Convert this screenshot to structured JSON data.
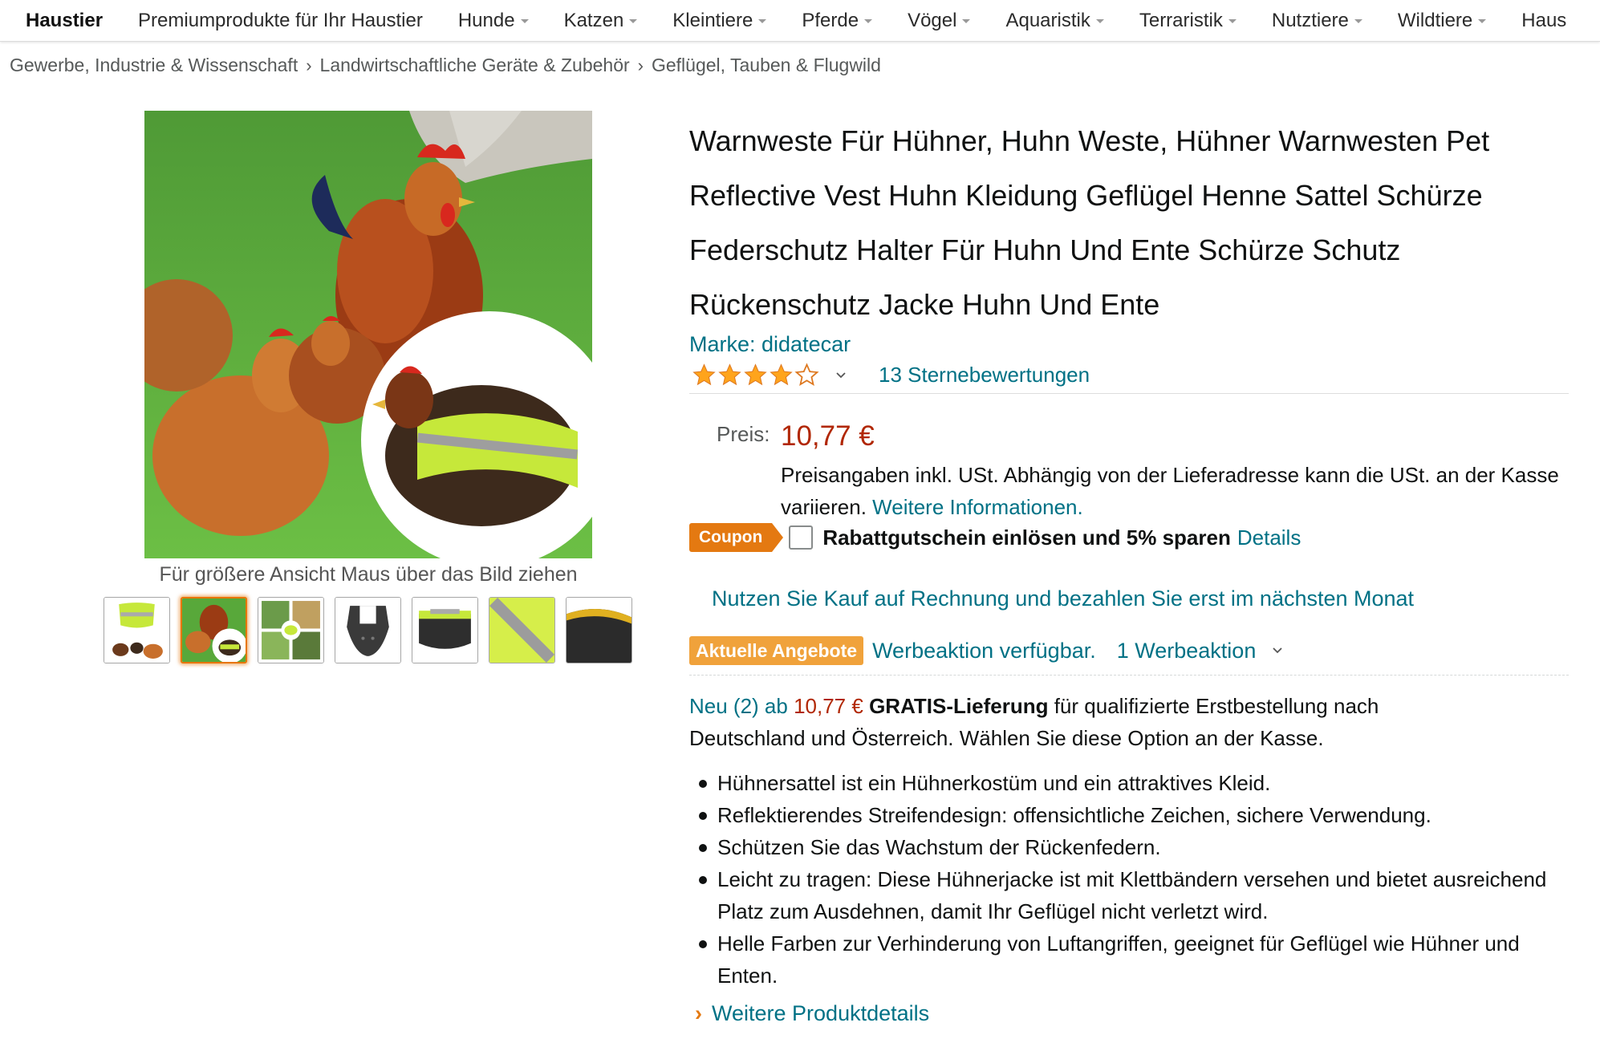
{
  "nav": {
    "first": "Haustier",
    "items": [
      {
        "label": "Premiumprodukte für Ihr Haustier",
        "caret": false
      },
      {
        "label": "Hunde",
        "caret": true
      },
      {
        "label": "Katzen",
        "caret": true
      },
      {
        "label": "Kleintiere",
        "caret": true
      },
      {
        "label": "Pferde",
        "caret": true
      },
      {
        "label": "Vögel",
        "caret": true
      },
      {
        "label": "Aquaristik",
        "caret": true
      },
      {
        "label": "Terraristik",
        "caret": true
      },
      {
        "label": "Nutztiere",
        "caret": true
      },
      {
        "label": "Wildtiere",
        "caret": true
      },
      {
        "label": "Haus",
        "caret": false
      }
    ]
  },
  "breadcrumb": [
    "Gewerbe, Industrie & Wissenschaft",
    "Landwirtschaftliche Geräte & Zubehör",
    "Geflügel, Tauben & Flugwild"
  ],
  "breadcrumb_separator": "›",
  "gallery": {
    "zoom_hint": "Für größere Ansicht Maus über das Bild ziehen",
    "active_thumbnail": 1,
    "thumbnail_count": 7
  },
  "product": {
    "title": "Warnweste Für Hühner, Huhn Weste, Hühner Warnwesten Pet Reflective Vest Huhn Kleidung Geflügel Henne Sattel Schürze Federschutz Halter Für Huhn Und Ente Schürze Schutz Rückenschutz Jacke Huhn Und Ente",
    "brand": "Marke: didatecar",
    "rating_stars": 4,
    "ratings_count": "13 Sternebewertungen"
  },
  "price": {
    "label": "Preis:",
    "value": "10,77 €",
    "vat_note": "Preisangaben inkl. USt. Abhängig von der Lieferadresse kann die USt. an der Kasse variieren.",
    "more_info": "Weitere Informationen."
  },
  "coupon": {
    "badge": "Coupon",
    "checked": false,
    "text": "Rabattgutschein einlösen und 5% sparen",
    "details": "Details"
  },
  "invoice_link": "Nutzen Sie Kauf auf Rechnung und bezahlen Sie erst im nächsten Monat",
  "deals": {
    "badge": "Aktuelle Angebote",
    "text": "Werbeaktion verfügbar.",
    "count": "1 Werbeaktion"
  },
  "offer": {
    "new_offers": "Neu (2) ab",
    "price": "10,77 €",
    "shipping_bold": "GRATIS-Lieferung",
    "shipping_text": "für qualifizierte Erstbestellung nach Deutschland und Österreich. Wählen Sie diese Option an der Kasse."
  },
  "bullets": [
    "Hühnersattel ist ein Hühnerkostüm und ein attraktives Kleid.",
    "Reflektierendes Streifendesign: offensichtliche Zeichen, sichere Verwendung.",
    "Schützen Sie das Wachstum der Rückenfedern.",
    "Leicht zu tragen: Diese Hühnerjacke ist mit Klettbändern versehen und bietet ausreichend Platz zum Ausdehnen, damit Ihr Geflügel nicht verletzt wird.",
    "Helle Farben zur Verhinderung von Luftangriffen, geeignet für Geflügel wie Hühner und Enten."
  ],
  "more_details": "Weitere Produktdetails",
  "colors": {
    "link": "#007185",
    "price": "#b12704",
    "coupon": "#e47911",
    "deals": "#f0a23b",
    "star": "#ffa41c"
  }
}
